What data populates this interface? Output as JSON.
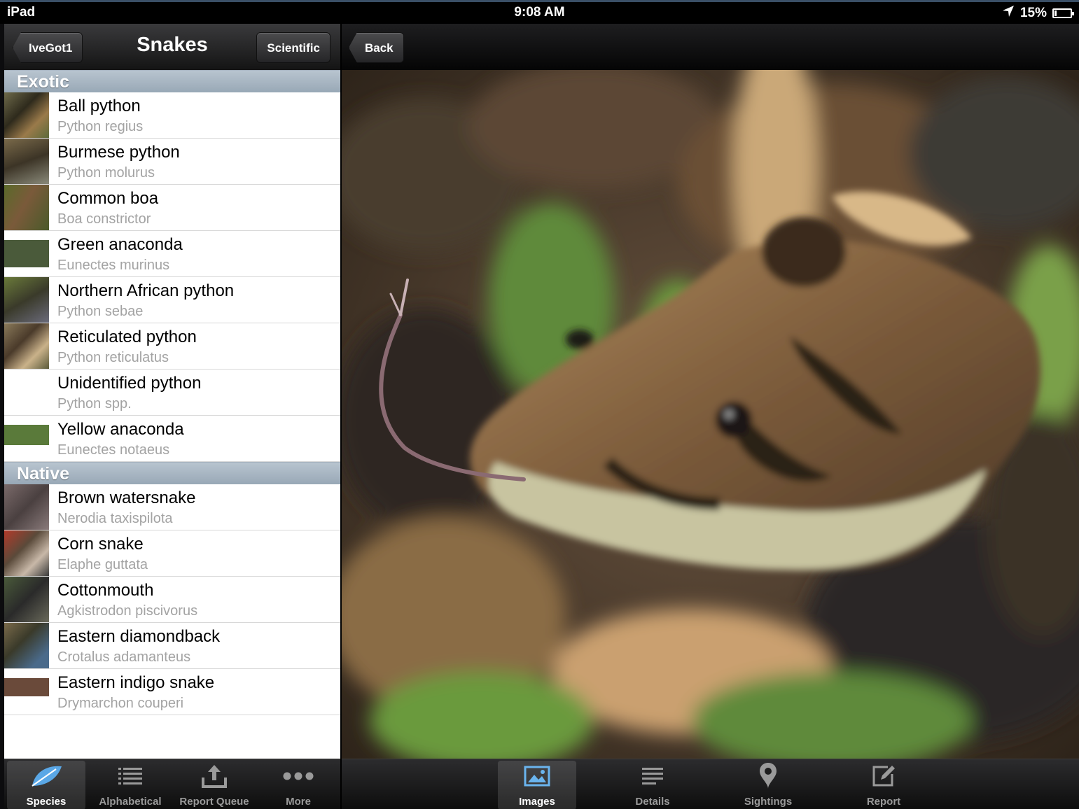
{
  "status": {
    "device": "iPad",
    "time": "9:08 AM",
    "battery": "15%",
    "battery_level": 0.15
  },
  "master": {
    "back_label": "IveGot1",
    "title": "Snakes",
    "toggle_label": "Scientific",
    "sections": [
      {
        "header": "Exotic",
        "items": [
          {
            "name": "Ball python",
            "sci": "Python regius"
          },
          {
            "name": "Burmese python",
            "sci": "Python molurus"
          },
          {
            "name": "Common boa",
            "sci": "Boa constrictor"
          },
          {
            "name": "Green anaconda",
            "sci": "Eunectes murinus"
          },
          {
            "name": "Northern African python",
            "sci": "Python sebae"
          },
          {
            "name": "Reticulated python",
            "sci": "Python reticulatus"
          },
          {
            "name": "Unidentified python",
            "sci": "Python spp."
          },
          {
            "name": "Yellow anaconda",
            "sci": "Eunectes notaeus"
          }
        ]
      },
      {
        "header": "Native",
        "items": [
          {
            "name": "Brown watersnake",
            "sci": "Nerodia taxispilota"
          },
          {
            "name": "Corn snake",
            "sci": "Elaphe guttata"
          },
          {
            "name": "Cottonmouth",
            "sci": "Agkistrodon piscivorus"
          },
          {
            "name": "Eastern diamondback",
            "sci": "Crotalus adamanteus"
          },
          {
            "name": "Eastern indigo snake",
            "sci": "Drymarchon couperi"
          }
        ]
      }
    ]
  },
  "left_tabs": [
    {
      "label": "Species",
      "icon": "leaf-icon",
      "active": true
    },
    {
      "label": "Alphabetical",
      "icon": "list-icon",
      "active": false
    },
    {
      "label": "Report Queue",
      "icon": "upload-icon",
      "active": false
    },
    {
      "label": "More",
      "icon": "more-icon",
      "active": false
    }
  ],
  "detail": {
    "back_label": "Back"
  },
  "right_tabs": [
    {
      "label": "Images",
      "icon": "image-icon",
      "active": true
    },
    {
      "label": "Details",
      "icon": "details-icon",
      "active": false
    },
    {
      "label": "Sightings",
      "icon": "map-pin-icon",
      "active": false
    },
    {
      "label": "Report",
      "icon": "compose-icon",
      "active": false
    }
  ],
  "colors": {
    "section_header": "#a8b6c3",
    "subtitle": "#a3a3a3",
    "active_tab": "#ffffff"
  }
}
